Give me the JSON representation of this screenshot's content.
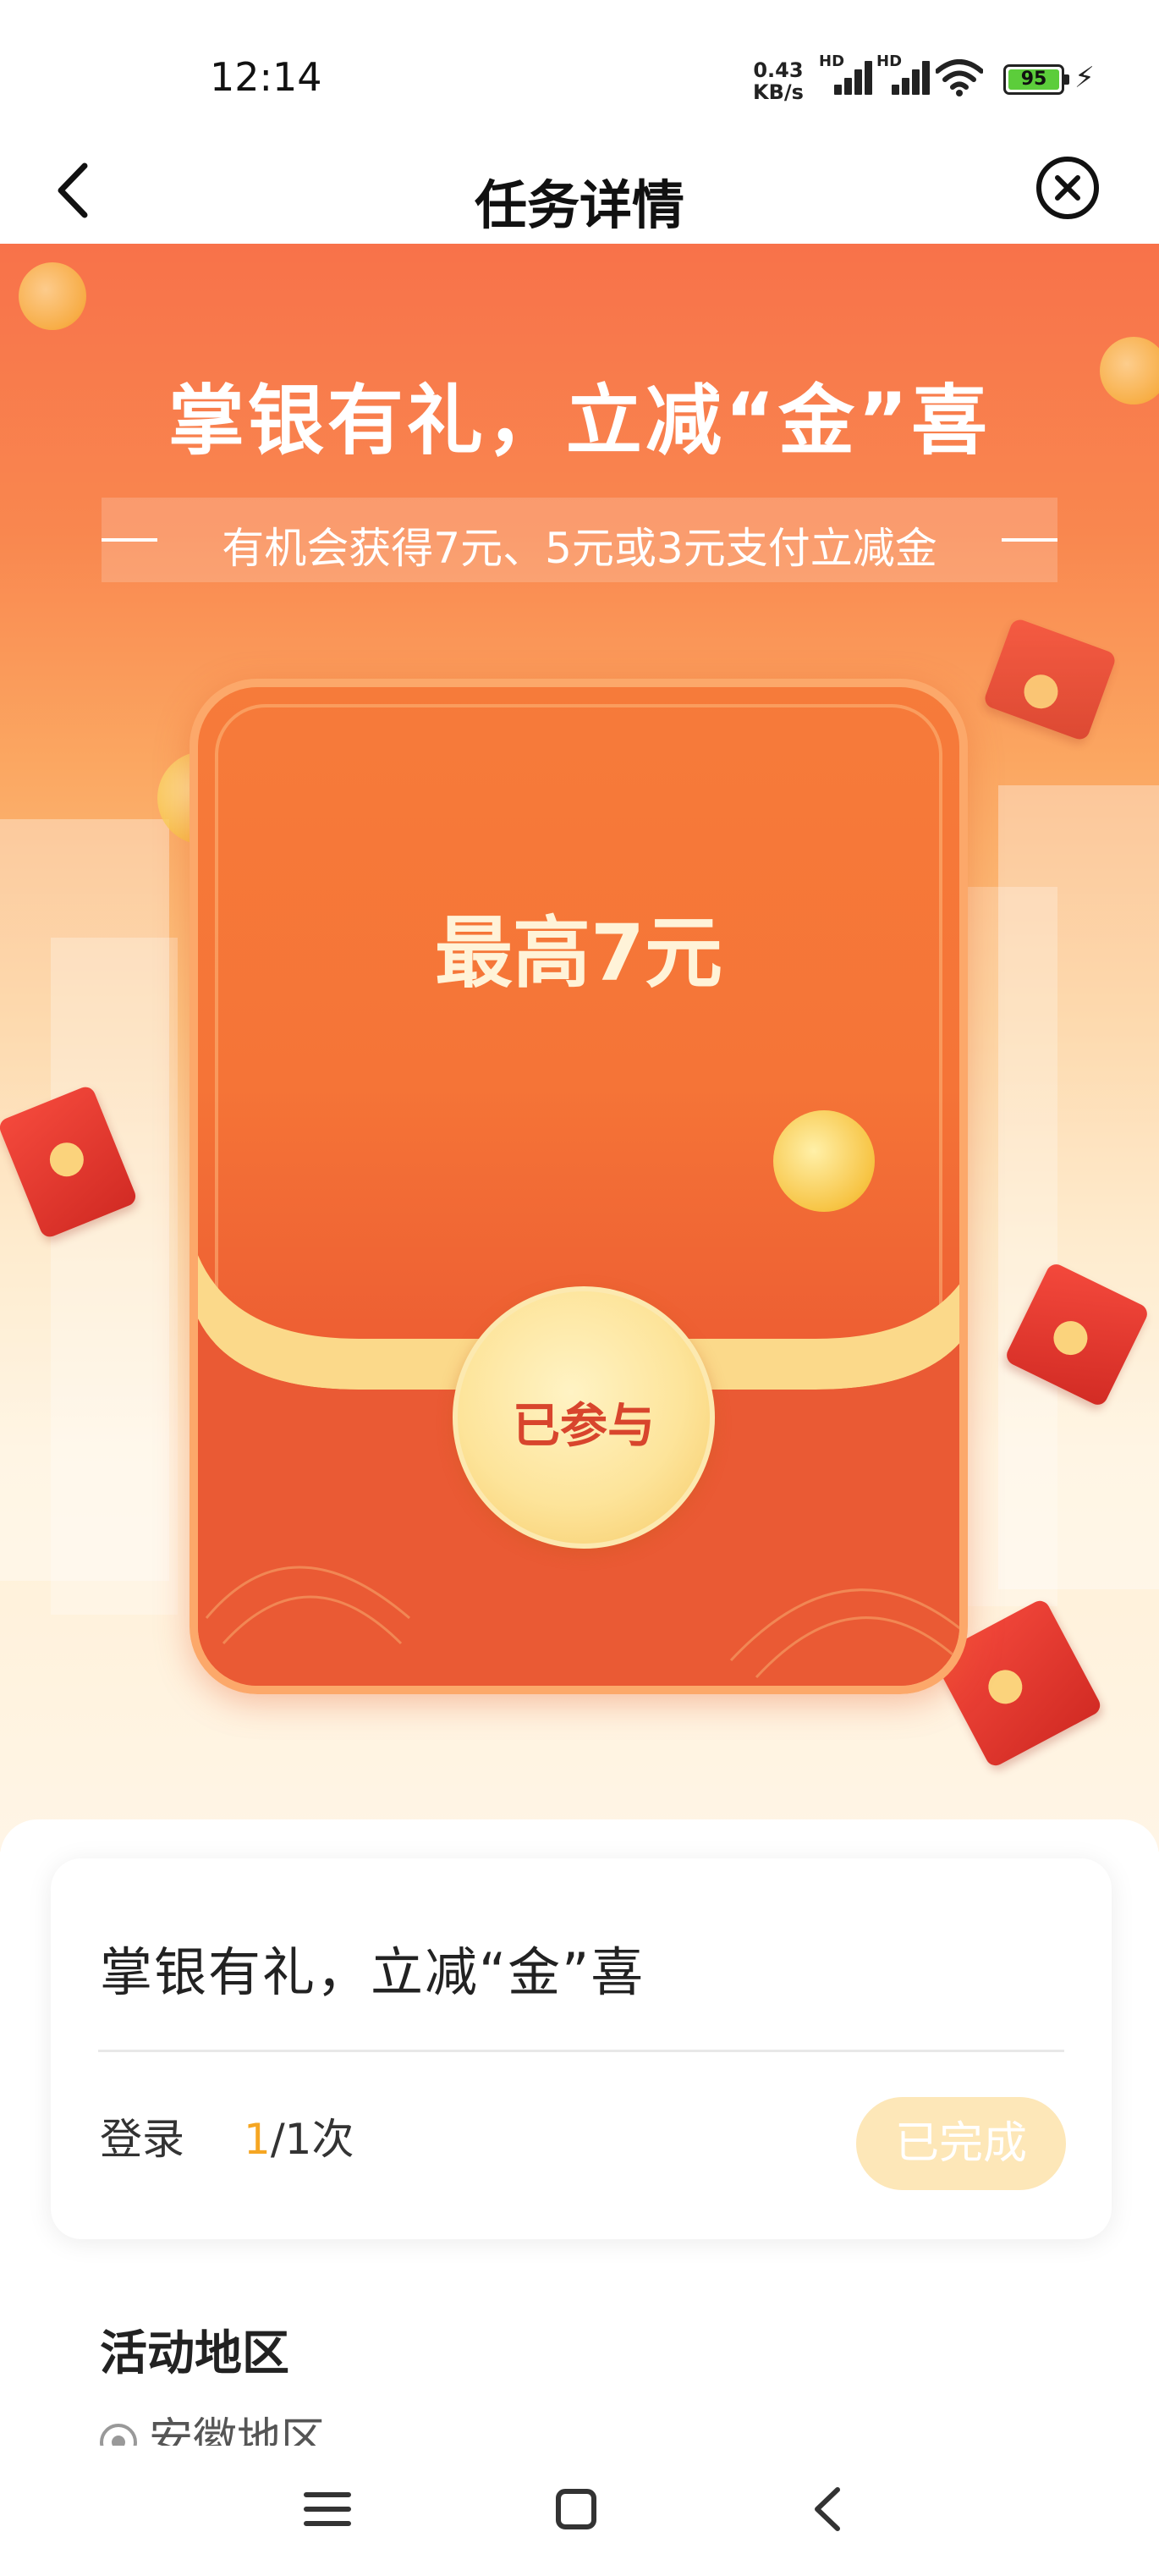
{
  "status_bar": {
    "time": "12:14",
    "net_speed_value": "0.43",
    "net_speed_unit": "KB/s",
    "signal_label_1": "HD",
    "signal_label_2": "HD",
    "battery": "95"
  },
  "nav": {
    "title": "任务详情",
    "back_icon": "chevron-left-icon",
    "close_icon": "close-circle-icon"
  },
  "hero": {
    "title": "掌银有礼，立减“金”喜",
    "subtitle": "有机会获得7元、5元或3元支付立减金",
    "envelope_text": "最高7元",
    "join_button": "已参与",
    "colors": {
      "top": "#f8724a",
      "bottom": "#fff5e6",
      "envelope": "#f57437"
    }
  },
  "task": {
    "title": "掌银有礼，立减“金”喜",
    "action_label": "登录",
    "progress_current": "1",
    "progress_rest": "/1次",
    "status_button": "已完成"
  },
  "region": {
    "title": "活动地区",
    "item": "安徽地区"
  },
  "system_nav": {
    "menu_icon": "menu-icon",
    "home_icon": "home-square-icon",
    "back_icon": "back-triangle-icon"
  }
}
